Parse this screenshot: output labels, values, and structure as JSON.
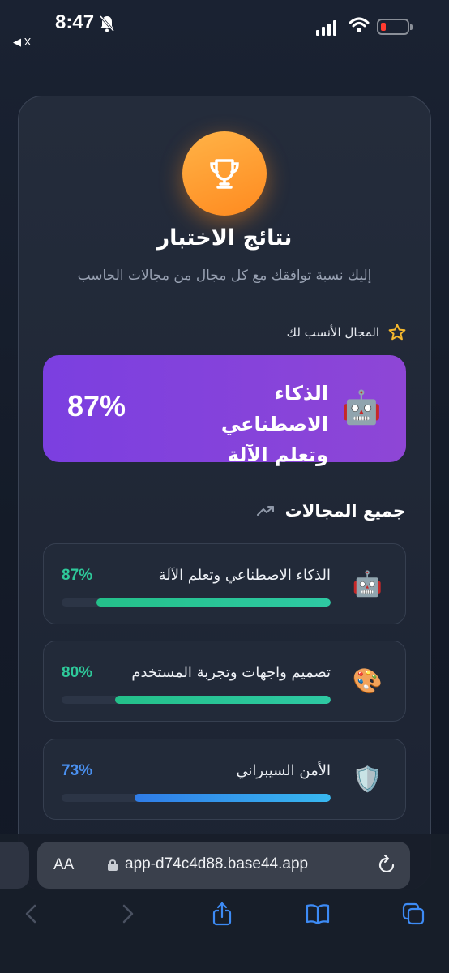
{
  "status_bar": {
    "time": "8:47",
    "back_app": "◀ X"
  },
  "page": {
    "title": "نتائج الاختبار",
    "subtitle": "إليك نسبة توافقك مع كل مجال من مجالات الحاسب",
    "best_label": "المجال الأنسب لك",
    "best": {
      "name": "الذكاء الاصطناعي وتعلم الآلة",
      "percent": "87%",
      "emoji": "🤖"
    },
    "all_title": "جميع المجالات",
    "fields": [
      {
        "name": "الذكاء الاصطناعي وتعلم الآلة",
        "percent": "87%",
        "emoji": "🤖",
        "value": 0.87,
        "color": "#2ec99a"
      },
      {
        "name": "تصميم واجهات وتجربة المستخدم",
        "percent": "80%",
        "emoji": "🎨",
        "value": 0.8,
        "color": "#2ec99a"
      },
      {
        "name": "الأمن السيبراني",
        "percent": "73%",
        "emoji": "🛡️",
        "value": 0.73,
        "color": "#4a90f0"
      }
    ]
  },
  "browser": {
    "aa_label": "AA",
    "url": "app-d74c4d88.base44.app"
  },
  "colors": {
    "accent_orange": "#ff9a2e",
    "best_purple": "#7b3fe0",
    "green": "#2ec99a",
    "blue": "#4a90f0"
  }
}
